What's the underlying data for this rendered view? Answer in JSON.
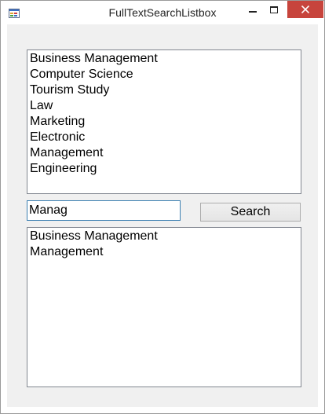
{
  "window": {
    "title": "FullTextSearchListbox",
    "controls": {
      "minimize_icon": "minimize-icon",
      "maximize_icon": "maximize-icon",
      "close_icon": "close-icon"
    },
    "colors": {
      "close_button": "#c7443c",
      "client_background": "#f0f0f0",
      "input_border": "#3c7fb1"
    }
  },
  "source_list": {
    "items": [
      "Business Management",
      "Computer Science",
      "Tourism Study",
      "Law",
      "Marketing",
      "Electronic",
      "Management",
      "Engineering"
    ]
  },
  "search": {
    "value": "Manag",
    "button_label": "Search"
  },
  "results_list": {
    "items": [
      "Business Management",
      "Management"
    ]
  }
}
